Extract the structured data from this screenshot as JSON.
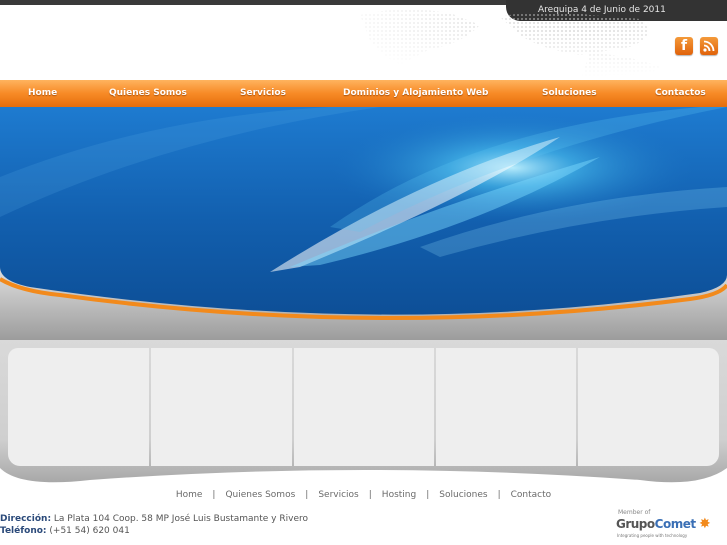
{
  "header": {
    "date_text": "Arequipa 4 de Junio de 2011",
    "social": [
      {
        "name": "facebook",
        "glyph": "f"
      },
      {
        "name": "rss",
        "glyph": "rss"
      }
    ]
  },
  "nav": {
    "items": [
      "Home",
      "Quienes Somos",
      "Servicios",
      "Dominios y Alojamiento Web",
      "Soluciones",
      "Contactos"
    ]
  },
  "footer": {
    "links": [
      "Home",
      "Quienes Somos",
      "Servicios",
      "Hosting",
      "Soluciones",
      "Contacto"
    ],
    "separator": "|",
    "address_label": "Dirección:",
    "address_value": "La Plata 104 Coop. 58 MP José Luis Bustamante y Rivero",
    "phone_label": "Teléfono:",
    "phone_value": "(+51 54) 620 041"
  },
  "partner": {
    "member_text": "Member of",
    "logo_text_a": "Grupo",
    "logo_text_b": "Comet",
    "tagline": "Integrating people with technology"
  },
  "colors": {
    "accent_orange": "#f78a26",
    "banner_blue": "#1a73c2",
    "dark_bar": "#333333"
  }
}
